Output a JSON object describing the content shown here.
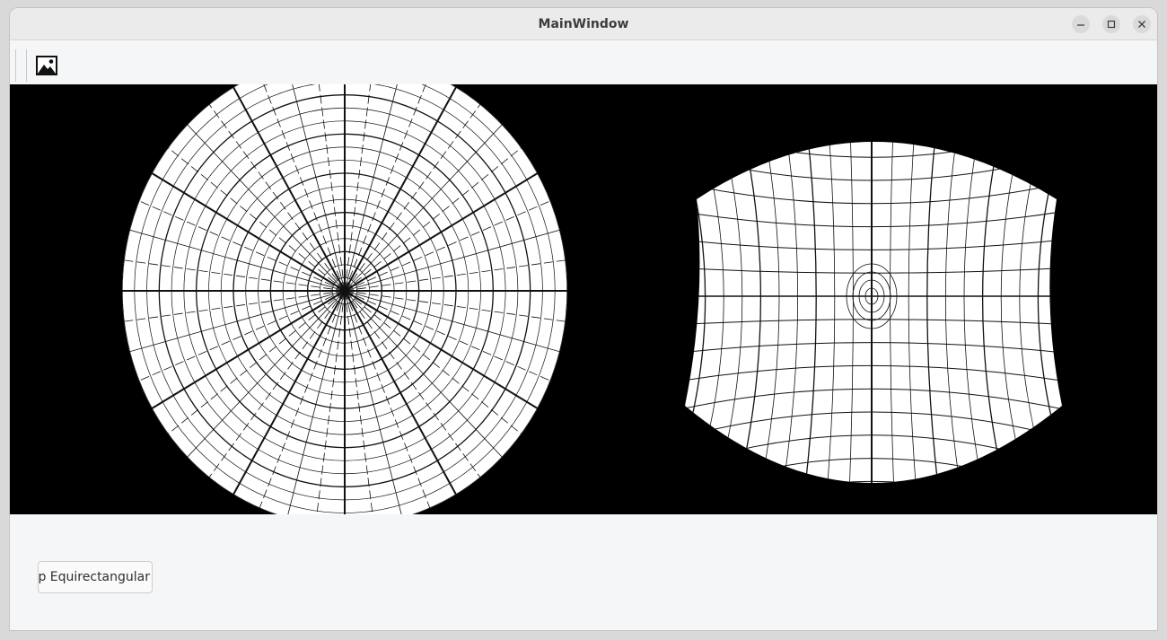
{
  "window": {
    "title": "MainWindow",
    "controls": {
      "minimize_icon": "minimize-icon",
      "maximize_icon": "maximize-icon",
      "close_icon": "close-icon"
    }
  },
  "toolbar": {
    "open_image_icon": "image-icon"
  },
  "viewer": {
    "left_image": "fisheye-polar-grid",
    "right_image": "equirectangular-remapped-grid"
  },
  "controls": {
    "projection_select_value": "FullMap Equirectangular"
  },
  "colors": {
    "viewer_background": "#000000",
    "grid_fill": "#ffffff",
    "grid_line": "#000000"
  }
}
